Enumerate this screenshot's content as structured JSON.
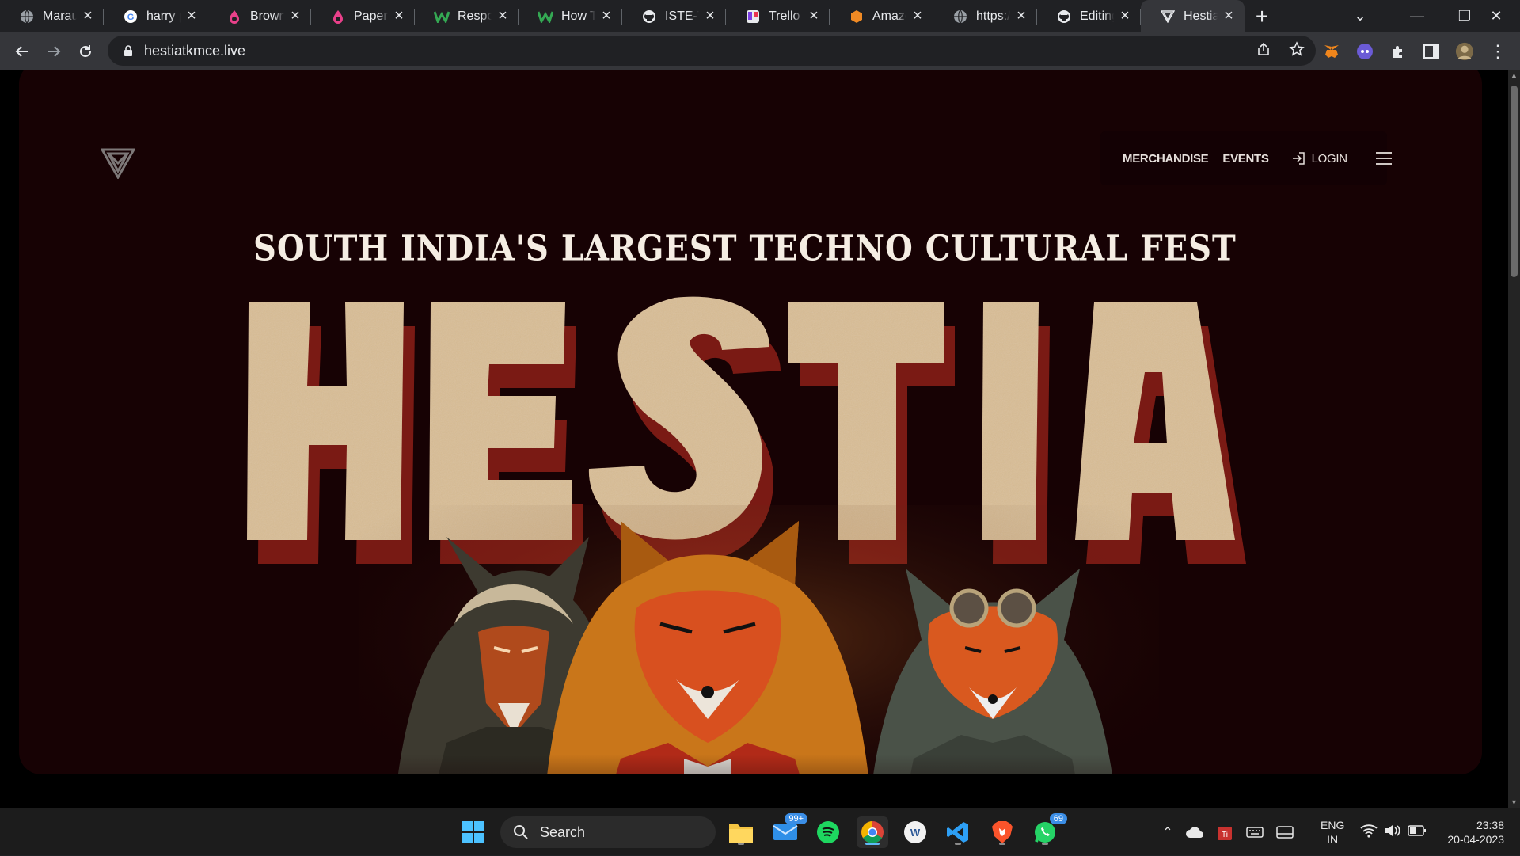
{
  "browser": {
    "tabs": [
      {
        "title": "Maraun",
        "icon": "globe-icon"
      },
      {
        "title": "harry pc",
        "icon": "google-icon"
      },
      {
        "title": "Brown p",
        "icon": "drop-icon"
      },
      {
        "title": "Paper g",
        "icon": "drop-icon"
      },
      {
        "title": "Respon",
        "icon": "w-logo-icon"
      },
      {
        "title": "How To",
        "icon": "w-logo-icon"
      },
      {
        "title": "ISTE-TK",
        "icon": "github-icon"
      },
      {
        "title": "Trello",
        "icon": "trello-icon"
      },
      {
        "title": "Amazor",
        "icon": "aws-icon"
      },
      {
        "title": "https://",
        "icon": "globe-icon"
      },
      {
        "title": "Editing",
        "icon": "github-icon"
      },
      {
        "title": "Hestia",
        "icon": "hestia-icon",
        "active": true
      }
    ],
    "url": "hestiatkmce.live"
  },
  "site": {
    "nav": {
      "merchandise": "MERCHANDISE",
      "events": "EVENTS",
      "login": "LOGIN"
    },
    "tagline": "SOUTH INDIA'S LARGEST TECHNO CULTURAL FEST",
    "title": "HESTIA",
    "colors": {
      "background": "#170204",
      "title_fill": "#d9bd94",
      "title_shadow": "#7a1a14",
      "tagline": "#f5ede3"
    }
  },
  "taskbar": {
    "search_label": "Search",
    "mail_badge": "99+",
    "whatsapp_badge": "69",
    "language_top": "ENG",
    "language_bottom": "IN",
    "time": "23:38",
    "date": "20-04-2023"
  }
}
